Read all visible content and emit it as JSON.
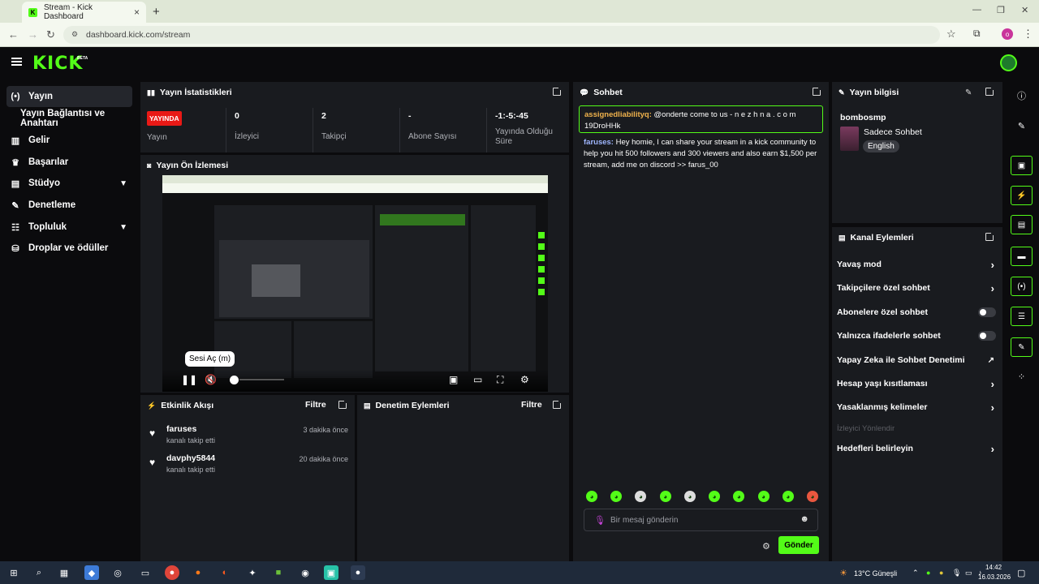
{
  "browser": {
    "tab_title": "Stream - Kick Dashboard",
    "tab_close": "×",
    "new_tab": "+",
    "url": "dashboard.kick.com/stream",
    "profile_initial": "o"
  },
  "topnav": {
    "logo": "KICK",
    "logo_badge": "BETA"
  },
  "sidebar": {
    "items": [
      {
        "label": "Yayın",
        "icon": "broadcast-icon"
      },
      {
        "label": "Yayın Bağlantısı ve Anahtarı",
        "icon": ""
      },
      {
        "label": "Gelir",
        "icon": "chart-icon"
      },
      {
        "label": "Başarılar",
        "icon": "trophy-icon"
      },
      {
        "label": "Stüdyo",
        "icon": "studio-icon"
      },
      {
        "label": "Denetleme",
        "icon": "wrench-icon"
      },
      {
        "label": "Topluluk",
        "icon": "community-icon"
      },
      {
        "label": "Droplar ve ödüller",
        "icon": "gift-icon"
      }
    ]
  },
  "stats": {
    "title": "Yayın İstatistikleri",
    "live_badge": "YAYINDA",
    "live_label": "Yayın",
    "viewers_value": "0",
    "viewers_label": "İzleyici",
    "followers_value": "2",
    "followers_label": "Takipçi",
    "subs_value": "-",
    "subs_label": "Abone Sayısı",
    "uptime_value": "-1:-5:-45",
    "uptime_label": "Yayında Olduğu Süre"
  },
  "preview": {
    "title": "Yayın Ön İzlemesi",
    "tooltip": "Sesi Aç (m)"
  },
  "activity": {
    "title": "Etkinlik Akışı",
    "filter": "Filtre",
    "items": [
      {
        "name": "faruses",
        "action": "kanalı takip etti",
        "time": "3 dakika önce"
      },
      {
        "name": "davphy5844",
        "action": "kanalı takip etti",
        "time": "20 dakika önce"
      }
    ]
  },
  "moderation": {
    "title": "Denetim Eylemleri",
    "filter": "Filtre"
  },
  "chat": {
    "title": "Sohbet",
    "pinned_user": "assignedliabilityq:",
    "pinned_text": " @onderte come to us - n e z h n a . c o m 19DroHHk",
    "msg_user": "faruses:",
    "msg_text": " Hey homie, I can share your stream in a kick community to help you hit 500 followers and 300 viewers and also earn $1,500 per stream, add me on discord >> farus_00",
    "input_placeholder": "Bir mesaj gönderin",
    "send": "Gönder"
  },
  "stream_info": {
    "title": "Yayın bilgisi",
    "channel": "bombosmp",
    "category": "Sadece Sohbet",
    "tag": "English"
  },
  "channel_actions": {
    "title": "Kanal Eylemleri",
    "items": [
      {
        "label": "Yavaş mod",
        "kind": "chevron"
      },
      {
        "label": "Takipçilere özel sohbet",
        "kind": "chevron"
      },
      {
        "label": "Abonelere özel sohbet",
        "kind": "toggle",
        "on": false
      },
      {
        "label": "Yalnızca ifadelerle sohbet",
        "kind": "toggle",
        "on": false
      },
      {
        "label": "Yapay Zeka ile Sohbet Denetimi",
        "kind": "external"
      },
      {
        "label": "Hesap yaşı kısıtlaması",
        "kind": "chevron"
      },
      {
        "label": "Yasaklanmış kelimeler",
        "kind": "chevron"
      },
      {
        "label": "İzleyici Yönlendir",
        "kind": "disabled"
      },
      {
        "label": "Hedefleri belirleyin",
        "kind": "chevron"
      }
    ]
  },
  "taskbar": {
    "weather": "13°C Güneşli",
    "time": "14:42",
    "date": "16.03.2026"
  },
  "colors": {
    "accent": "#53fc18",
    "live": "#e91916",
    "panel": "#191b1f"
  }
}
